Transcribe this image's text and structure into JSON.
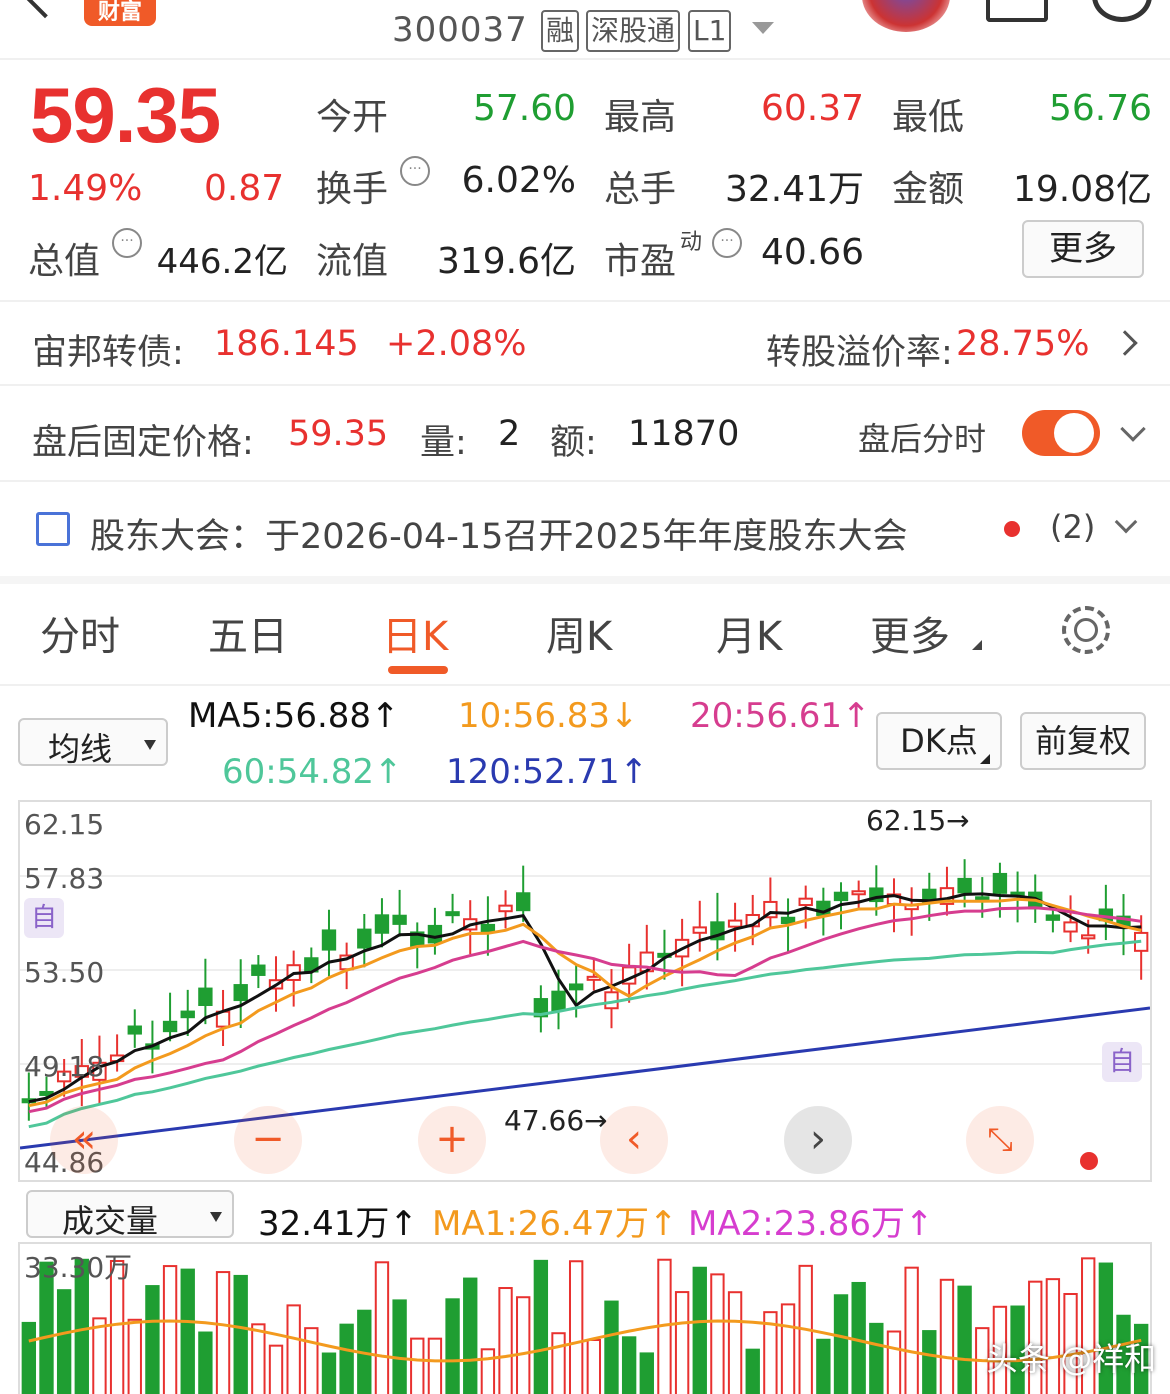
{
  "header": {
    "brand": "财富",
    "stock_code": "300037",
    "tags": [
      "融",
      "深股通",
      "L1"
    ]
  },
  "quote": {
    "price": "59.35",
    "change_pct": "1.49%",
    "change": "0.87",
    "fields": {
      "open": {
        "label": "今开",
        "value": "57.60"
      },
      "high": {
        "label": "最高",
        "value": "60.37"
      },
      "low": {
        "label": "最低",
        "value": "56.76"
      },
      "turnover": {
        "label": "换手",
        "value": "6.02%"
      },
      "volume": {
        "label": "总手",
        "value": "32.41万"
      },
      "amount": {
        "label": "金额",
        "value": "19.08亿"
      },
      "market_cap": {
        "label": "总值",
        "value": "446.2亿"
      },
      "float_cap": {
        "label": "流值",
        "value": "319.6亿"
      },
      "pe": {
        "label": "市盈",
        "sup": "动",
        "value": "40.66"
      }
    },
    "more_label": "更多"
  },
  "bond": {
    "label": "宙邦转债:",
    "price": "186.145",
    "pct": "+2.08%",
    "premium_label": "转股溢价率:",
    "premium": "28.75%"
  },
  "after_hours": {
    "label": "盘后固定价格:",
    "price": "59.35",
    "vol_label": "量:",
    "vol": "2",
    "amt_label": "额:",
    "amt": "11870",
    "timeshare_label": "盘后分时",
    "toggle_on": true
  },
  "notice": {
    "text": "股东大会：于2026-04-15召开2025年年度股东大会",
    "count": "(2)"
  },
  "tabs": [
    "分时",
    "五日",
    "日K",
    "周K",
    "月K",
    "更多"
  ],
  "active_tab": "日K",
  "ma": {
    "select_label": "均线",
    "ma5": "MA5:56.88↑",
    "ma10": "10:56.83↓",
    "ma20": "20:56.61↑",
    "ma60": "60:54.82↑",
    "ma120": "120:52.71↑",
    "dk_label": "DK点",
    "fq_label": "前复权"
  },
  "kchart": {
    "y_labels": [
      "62.15",
      "57.83",
      "53.50",
      "49.18",
      "44.86"
    ],
    "high_mark": "62.15→",
    "low_mark": "47.66→",
    "auto_tag": "自",
    "colors": {
      "up": "#e8312f",
      "down": "#1f9e32",
      "ma5": "#111111",
      "ma10": "#f39a1e",
      "ma20": "#d63d8f",
      "ma60": "#4fc79a",
      "ma120": "#2a3ab0"
    }
  },
  "volume": {
    "select_label": "成交量",
    "current": "32.41万↑",
    "ma1": "MA1:26.47万↑",
    "ma2": "MA2:23.86万↑",
    "max_label": "33.30万"
  },
  "watermark": "头条 @祥和"
}
